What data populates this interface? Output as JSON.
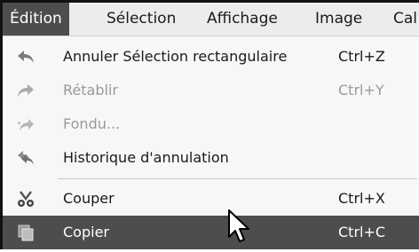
{
  "menubar": {
    "items": [
      {
        "label": "Édition",
        "active": true
      },
      {
        "label": "Sélection",
        "active": false
      },
      {
        "label": "Affichage",
        "active": false
      },
      {
        "label": "Image",
        "active": false
      },
      {
        "label": "Cal",
        "active": false
      }
    ]
  },
  "menu": {
    "items": [
      {
        "label": "Annuler Sélection rectangulaire",
        "shortcut": "Ctrl+Z",
        "icon": "undo-icon",
        "disabled": false
      },
      {
        "label": "Rétablir",
        "shortcut": "Ctrl+Y",
        "icon": "redo-icon",
        "disabled": true
      },
      {
        "label": "Fondu...",
        "shortcut": "",
        "icon": "fade-icon",
        "disabled": true
      },
      {
        "label": "Historique d'annulation",
        "shortcut": "",
        "icon": "history-icon",
        "disabled": false
      },
      {
        "label": "Couper",
        "shortcut": "Ctrl+X",
        "icon": "scissors-icon",
        "disabled": false
      },
      {
        "label": "Copier",
        "shortcut": "Ctrl+C",
        "icon": "copy-icon",
        "disabled": false,
        "selected": true
      }
    ]
  },
  "colors": {
    "highlight": "#4d4d4d",
    "menu_bg": "#f7f7f7",
    "disabled_text": "#9a9a9a"
  }
}
